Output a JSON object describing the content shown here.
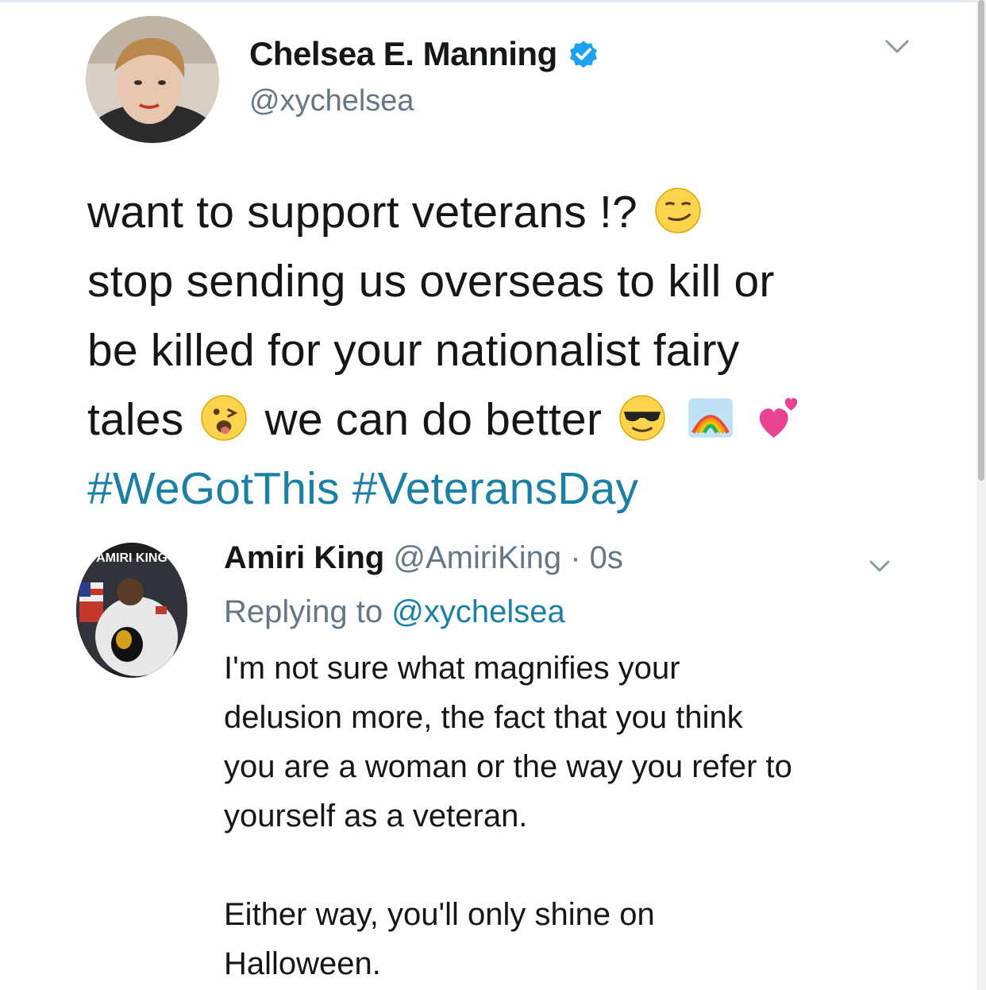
{
  "main_tweet": {
    "display_name": "Chelsea E. Manning",
    "handle": "@xychelsea",
    "lines": [
      "want to support veterans !?",
      "stop sending us overseas to kill or",
      "be killed for your nationalist fairy",
      "tales",
      "we can do better"
    ],
    "hashtags": [
      "#WeGotThis",
      "#VeteransDay"
    ],
    "emojis": [
      "smirking-face",
      "winking-tongue-face",
      "sunglasses-face",
      "rainbow",
      "two-hearts"
    ],
    "verified": true
  },
  "reply_tweet": {
    "display_name": "Amiri King",
    "handle": "@AmiriKing",
    "time": "· 0s",
    "replying_label": "Replying to",
    "replying_handle": "@xychelsea",
    "avatar_text": "AMIRI KING",
    "lines": [
      "I'm not sure what magnifies your",
      "delusion more, the fact that you think",
      "you are a woman or the way you refer to",
      "yourself as a veteran.",
      "Either way, you'll only shine on",
      "Halloween."
    ]
  },
  "colors": {
    "link": "#1b7fa6",
    "verified": "#1da1f2",
    "muted": "#657786",
    "text": "#14171a"
  }
}
